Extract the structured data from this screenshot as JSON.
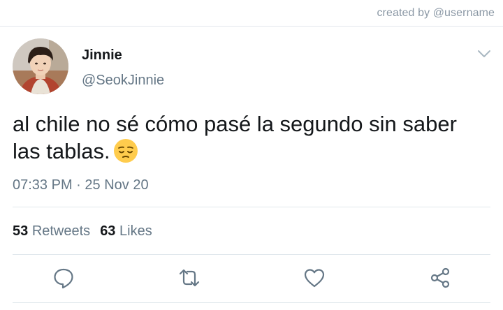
{
  "watermark": "created by @username",
  "tweet": {
    "author": {
      "name": "Jinnie",
      "handle": "@SeokJinnie"
    },
    "text_line1": "al chile no sé cómo pasé la segundo sin saber",
    "text_line2": "las tablas.",
    "emoji": "pensive-face",
    "time": "07:33 PM",
    "separator": "·",
    "date": "25 Nov 20",
    "stats": {
      "retweets_count": "53",
      "retweets_label": "Retweets",
      "likes_count": "63",
      "likes_label": "Likes"
    },
    "actions": [
      "reply-icon",
      "retweet-icon",
      "like-icon",
      "share-icon"
    ]
  },
  "colors": {
    "text_primary": "#14171a",
    "text_secondary": "#657786",
    "divider": "#e1e8ed",
    "icon": "#657786"
  }
}
